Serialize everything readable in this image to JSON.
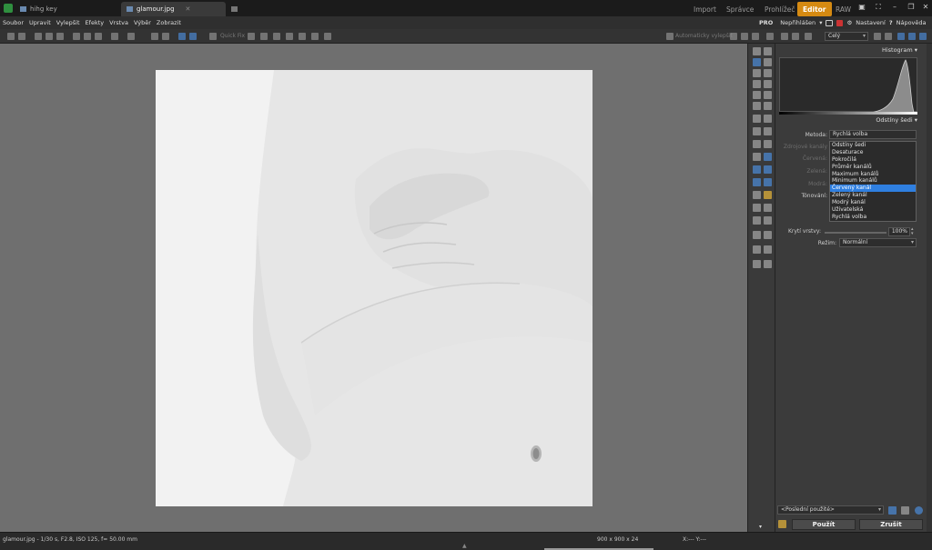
{
  "tabs": [
    {
      "label": "hihg key",
      "close": "✕"
    },
    {
      "label": "glamour.jpg",
      "close": "✕"
    }
  ],
  "modes": [
    "Import",
    "Správce",
    "Prohlížeč",
    "Editor",
    "RAW"
  ],
  "menu": [
    "Soubor",
    "Upravit",
    "Vylepšit",
    "Efekty",
    "Vrstva",
    "Výběr",
    "Zobrazit"
  ],
  "menu_right": {
    "pro": "PRO",
    "signin": "Nepřihlášen",
    "settings": "Nastavení",
    "help": "Nápověda"
  },
  "toolbar": {
    "quick_fix": "Quick Fix",
    "auto_enhance": "Automaticky vylepšit",
    "zoom": "Celý"
  },
  "panel": {
    "histogram_title": "Histogram",
    "grayscale_title": "Odstíny šedi",
    "method_label": "Metoda:",
    "method_value": "Rychlá volba",
    "dim_labels": [
      "Zdrojové kanály",
      "Červená:",
      "Zelená:",
      "Modrá:"
    ],
    "toning_label": "Tónování:",
    "options": [
      "Odstíny šedi",
      "Desaturace",
      "Pokročilá",
      "Průměr kanálů",
      "Maximum kanálů",
      "Minimum kanálů",
      "Červený kanál",
      "Zelený kanál",
      "Modrý kanál",
      "Uživatelská",
      "Rychlá volba"
    ],
    "selected_option": "Červený kanál",
    "opacity_label": "Krytí vrstvy:",
    "opacity_value": "100%",
    "mode_label": "Režim:",
    "mode_value": "Normální",
    "preset": "<Poslední použité>",
    "apply": "Použít",
    "cancel": "Zrušit"
  },
  "status": {
    "exif": "glamour.jpg - 1/30 s, F2.8, ISO 125, f= 50.00 mm",
    "dimensions": "900 x 900 x 24",
    "coords": "X:--- Y:---"
  },
  "colors": {
    "accent": "#d58a12",
    "selection": "#2f7fe0"
  }
}
